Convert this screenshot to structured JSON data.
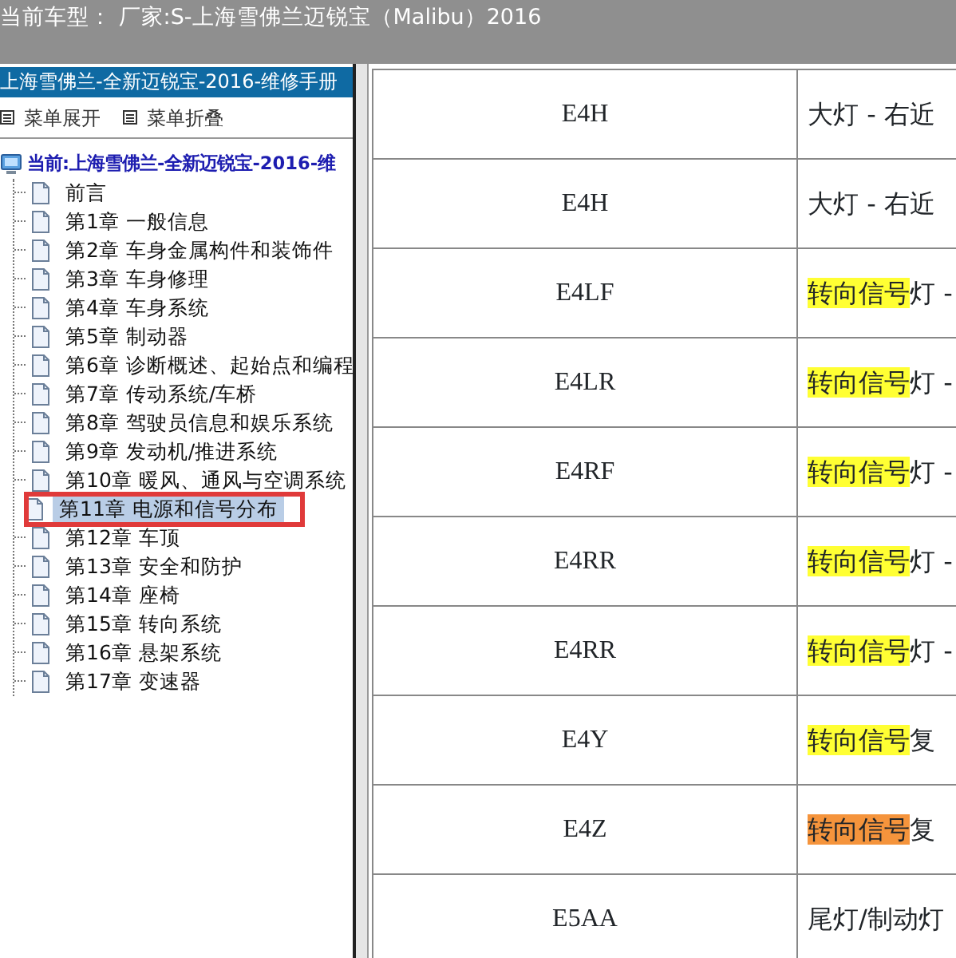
{
  "title_bar": {
    "title": "当前车型：  厂家:S-上海雪佛兰迈锐宝（Malibu）2016"
  },
  "sidebar": {
    "header": "上海雪佛兰-全新迈锐宝-2016-维修手册",
    "menu_buttons": [
      "菜单展开",
      "菜单折叠"
    ],
    "tree": {
      "label": "当前:上海雪佛兰-全新迈锐宝-2016-维",
      "children": [
        {
          "label": "前言",
          "selected": false,
          "outlined": false
        },
        {
          "label": "第1章 一般信息",
          "selected": false,
          "outlined": false
        },
        {
          "label": "第2章 车身金属构件和装饰件",
          "selected": false,
          "outlined": false
        },
        {
          "label": "第3章 车身修理",
          "selected": false,
          "outlined": false
        },
        {
          "label": "第4章 车身系统",
          "selected": false,
          "outlined": false
        },
        {
          "label": "第5章 制动器",
          "selected": false,
          "outlined": false
        },
        {
          "label": "第6章 诊断概述、起始点和编程",
          "selected": false,
          "outlined": false
        },
        {
          "label": "第7章 传动系统/车桥",
          "selected": false,
          "outlined": false
        },
        {
          "label": "第8章 驾驶员信息和娱乐系统",
          "selected": false,
          "outlined": false
        },
        {
          "label": "第9章 发动机/推进系统",
          "selected": false,
          "outlined": false
        },
        {
          "label": "第10章 暖风、通风与空调系统",
          "selected": false,
          "outlined": false
        },
        {
          "label": "第11章 电源和信号分布",
          "selected": true,
          "outlined": true
        },
        {
          "label": "第12章 车顶",
          "selected": false,
          "outlined": false
        },
        {
          "label": "第13章 安全和防护",
          "selected": false,
          "outlined": false
        },
        {
          "label": "第14章 座椅",
          "selected": false,
          "outlined": false
        },
        {
          "label": "第15章 转向系统",
          "selected": false,
          "outlined": false
        },
        {
          "label": "第16章 悬架系统",
          "selected": false,
          "outlined": false
        },
        {
          "label": "第17章 变速器",
          "selected": false,
          "outlined": false
        }
      ]
    }
  },
  "table": {
    "rows": [
      {
        "code": "E4H",
        "text": "大灯 - 右近"
      },
      {
        "code": "E4H",
        "text": "大灯 - 右近"
      },
      {
        "code": "E4LF",
        "highlight": {
          "text": "转向信号",
          "color": "#ffff33"
        },
        "text": "灯 -"
      },
      {
        "code": "E4LR",
        "highlight": {
          "text": "转向信号",
          "color": "#ffff33"
        },
        "text": "灯 -"
      },
      {
        "code": "E4RF",
        "highlight": {
          "text": "转向信号",
          "color": "#ffff33"
        },
        "text": "灯 -"
      },
      {
        "code": "E4RR",
        "highlight": {
          "text": "转向信号",
          "color": "#ffff33"
        },
        "text": "灯 -"
      },
      {
        "code": "E4RR",
        "highlight": {
          "text": "转向信号",
          "color": "#ffff33"
        },
        "text": "灯 -"
      },
      {
        "code": "E4Y",
        "highlight": {
          "text": "转向信号",
          "color": "#ffff33"
        },
        "text": "复"
      },
      {
        "code": "E4Z",
        "highlight": {
          "text": "转向信号",
          "color": "#f5943c"
        },
        "text": "复"
      },
      {
        "code": "E5AA",
        "text": "尾灯/制动灯"
      }
    ]
  }
}
